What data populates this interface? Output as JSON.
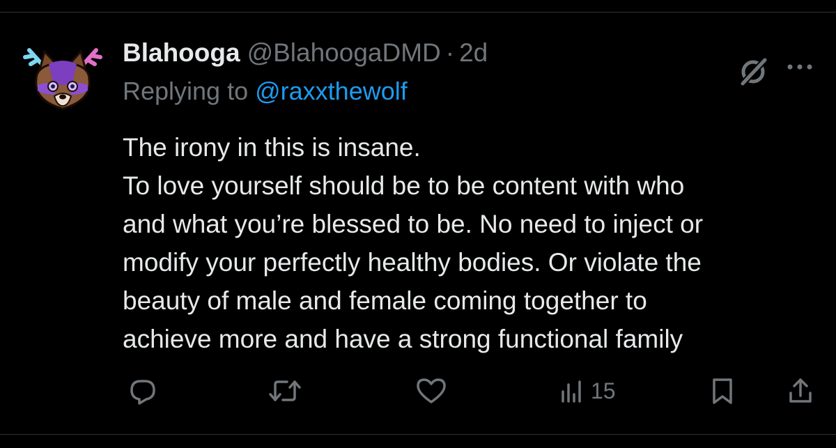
{
  "tweet": {
    "display_name": "Blahooga",
    "handle": "@BlahoogaDMD",
    "separator": "·",
    "time": "2d",
    "replying_prefix": "Replying to ",
    "replying_handle": "@raxxthewolf",
    "lines": [
      "The irony in this is insane.",
      "To love yourself should be to be content with who",
      "and what you’re blessed to be. No need to inject or",
      "modify your perfectly healthy bodies. Or violate the",
      "beauty of male and female coming together to",
      "achieve more and have a strong functional family"
    ]
  },
  "actions": {
    "reply_icon": "reply-icon",
    "repost_icon": "repost-icon",
    "like_icon": "heart-icon",
    "views_icon": "views-icon",
    "views_count": "15",
    "bookmark_icon": "bookmark-icon",
    "share_icon": "share-icon"
  },
  "colors": {
    "background": "#000000",
    "text": "#e7e9ea",
    "muted": "#71767b",
    "link": "#1d9bf0",
    "divider": "#2f3336"
  }
}
